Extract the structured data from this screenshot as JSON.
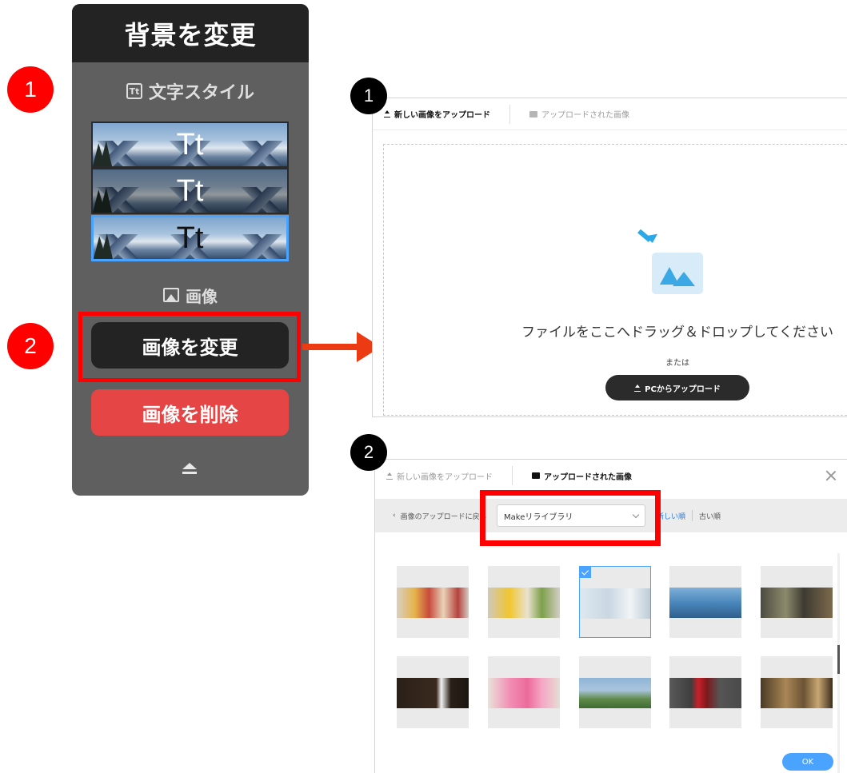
{
  "left_panel": {
    "title": "背景を変更",
    "text_style_label": "文字スタイル",
    "text_style_icon": "text-style-icon",
    "thumb_text": "Tt",
    "image_label": "画像",
    "image_icon": "image-icon",
    "change_image_button": "画像を変更",
    "delete_image_button": "画像を削除",
    "collapse_icon": "eject-icon"
  },
  "badges": {
    "left_1": "1",
    "left_2": "2",
    "right_1": "1",
    "right_2": "2"
  },
  "upload_dialog": {
    "tab_new": "新しい画像をアップロード",
    "tab_uploaded": "アップロードされた画像",
    "drop_text": "ファイルをここへドラッグ＆ドロップしてください",
    "or_text": "または",
    "pc_upload_button": "PCからアップロード"
  },
  "library_dialog": {
    "tab_new": "新しい画像をアップロード",
    "tab_uploaded": "アップロードされた画像",
    "back_link": "画像のアップロードに戻る",
    "library_select": "Makeリライブラリ",
    "sort_new": "新しい順",
    "sort_old": "古い順",
    "ok_button": "OK",
    "images": [
      {
        "name": "tarts",
        "color": "linear-gradient(90deg,#d8cfc5 0%,#e5b34a 25%,#c84a3c 45%,#e8d3b8 65%,#b6423e 85%,#d5ccc4 100%)",
        "selected": false
      },
      {
        "name": "lemon-tarts",
        "color": "linear-gradient(90deg,#cfc8bc 0%,#f0c62e 30%,#e9e2cf 55%,#7da04a 75%,#d4cec4 100%)",
        "selected": false
      },
      {
        "name": "desk-laptop",
        "color": "linear-gradient(90deg,#dfe8ef 0%,#c9d7e2 40%,#f1f4f6 70%,#b8c8d6 100%)",
        "selected": true
      },
      {
        "name": "mountain-lake",
        "color": "linear-gradient(180deg,#7fb0d8 0%,#4a86bb 50%,#2f5f8c 100%)",
        "selected": false
      },
      {
        "name": "market-stall",
        "color": "linear-gradient(90deg,#4c4a40 0%,#8c8a6c 35%,#3d3a32 60%,#7d6a4c 100%)",
        "selected": false
      },
      {
        "name": "soccer-ball",
        "color": "linear-gradient(90deg,#2a2018 0%,#3a2a1e 55%,#f2f2f2 62%,#2a2018 75%,#1c1510 100%)",
        "selected": false
      },
      {
        "name": "sticky-notes",
        "color": "linear-gradient(90deg,#e9e2da 0%,#f28fb4 30%,#ec6a9a 55%,#f5a6c4 75%,#e6ddd4 100%)",
        "selected": false
      },
      {
        "name": "green-field",
        "color": "linear-gradient(180deg,#8fb4d6 0%,#a9c5de 40%,#5f8a4a 70%,#3f6b32 100%)",
        "selected": false
      },
      {
        "name": "strawberries",
        "color": "linear-gradient(90deg,#5a5a5a 0%,#3e3e3e 30%,#c8202a 40%,#7d1a1c 52%,#555 70%,#4a4a4a 100%)",
        "selected": false
      },
      {
        "name": "celebration",
        "color": "linear-gradient(90deg,#4a3a24 0%,#a98656 35%,#6c5434 60%,#c7a672 80%,#3c2e1c 100%)",
        "selected": false
      }
    ]
  }
}
